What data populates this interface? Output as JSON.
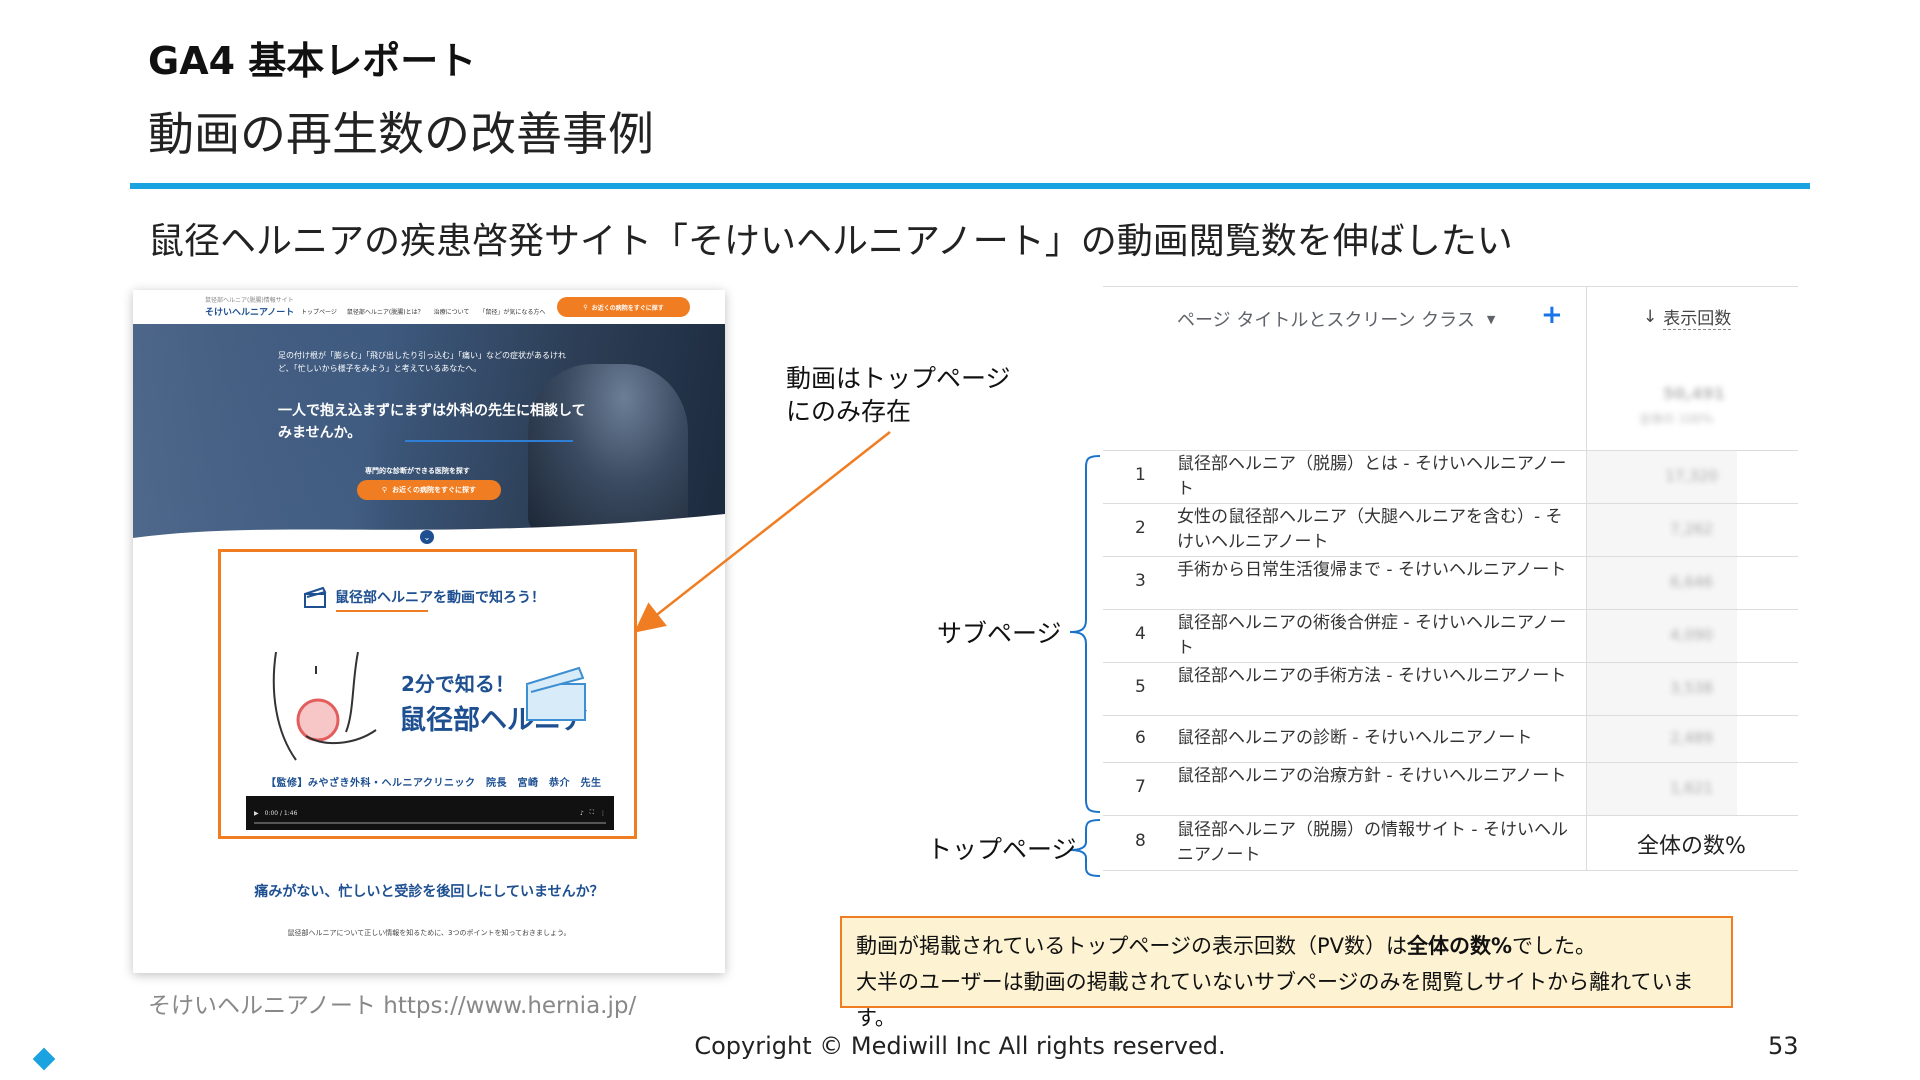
{
  "slide": {
    "title_small": "GA4 基本レポート",
    "title_large": "動画の再生数の改善事例",
    "subtitle": "鼠径ヘルニアの疾患啓発サイト「そけいヘルニアノート」の動画閲覧数を伸ばしたい",
    "accent_color": "#1aa3e0",
    "highlight_color": "#f07d21"
  },
  "site": {
    "tagline": "鼠径部ヘルニア(脱腸)情報サイト",
    "logo": "そけいヘルニアノート",
    "nav_links": [
      "トップページ",
      "鼠径部ヘルニア(脱腸)とは？",
      "治療について",
      "「鼠径」が気になる方へ"
    ],
    "nav_cta": "お近くの病院をすぐに探す",
    "hero_text": "足の付け根が「膨らむ」「飛び出したり引っ込む」「痛い」などの症状があるけれど、「忙しいから様子をみよう」と考えているあなたへ。",
    "hero_headline": "一人で抱え込まずにまずは外科の先生に相談してみませんか。",
    "hero_note": "専門的な診断ができる医院を探す",
    "hero_cta": "お近くの病院をすぐに探す",
    "video_heading": "鼠径部ヘルニアを動画で知ろう！",
    "video_big_small": "2分で知る！",
    "video_big_main": "鼠径部ヘルニア",
    "video_credit": "【監修】みやざき外科・ヘルニアクリニック　院長　宮崎　恭介　先生",
    "video_time": "0:00 / 1:46",
    "bottom_question": "痛みがない、忙しいと受診を後回しにしていませんか？",
    "bottom_sub": "鼠径部ヘルニアについて正しい情報を知るために、3つのポイントを知っておきましょう。",
    "caption": "そけいヘルニアノート https://www.hernia.jp/"
  },
  "callout": {
    "line1": "動画はトップページ",
    "line2": "にのみ存在"
  },
  "ga_table": {
    "dimension_header": "ページ タイトルとスクリーン クラス",
    "add_button": "+",
    "metric_header": "表示回数",
    "total_value": "50,491",
    "total_sub": "全体の 100%",
    "rows": [
      {
        "rank": "1",
        "title": "鼠径部ヘルニア（脱腸）とは - そけいヘルニアノート",
        "views": "17,320"
      },
      {
        "rank": "2",
        "title": "女性の鼠径部ヘルニア（大腿ヘルニアを含む）- そけいヘルニアノート",
        "views": "7,262"
      },
      {
        "rank": "3",
        "title": "手術から日常生活復帰まで - そけいヘルニアノート",
        "views": "6,646"
      },
      {
        "rank": "4",
        "title": "鼠径部ヘルニアの術後合併症 - そけいヘルニアノート",
        "views": "4,090"
      },
      {
        "rank": "5",
        "title": "鼠径部ヘルニアの手術方法 - そけいヘルニアノート",
        "views": "3,538"
      },
      {
        "rank": "6",
        "title": "鼠径部ヘルニアの診断 - そけいヘルニアノート",
        "views": "2,489"
      },
      {
        "rank": "7",
        "title": "鼠径部ヘルニアの治療方針 - そけいヘルニアノート",
        "views": "1,621"
      },
      {
        "rank": "8",
        "title": "鼠径部ヘルニア（脱腸）の情報サイト - そけいヘルニアノート",
        "views": "全体の数%"
      }
    ]
  },
  "labels": {
    "subpages": "サブページ",
    "toppage": "トップページ"
  },
  "note": {
    "line1_pre": "動画が掲載されているトップページの表示回数（PV数）は",
    "line1_bold": "全体の数%",
    "line1_post": "でした。",
    "line2": "大半のユーザーは動画の掲載されていないサブページのみを閲覧しサイトから離れています。"
  },
  "footer": {
    "copyright": "Copyright © Mediwill Inc All rights reserved.",
    "page_number": "53"
  }
}
